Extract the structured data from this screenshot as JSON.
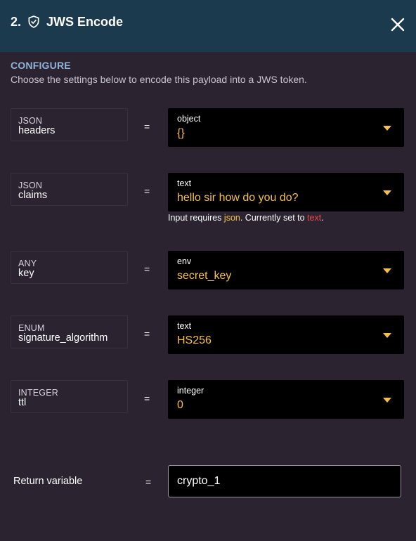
{
  "header": {
    "step_number": "2.",
    "title": "JWS Encode",
    "icon": "shield-check-icon",
    "close_icon": "close-icon"
  },
  "configure": {
    "label": "CONFIGURE",
    "description": "Choose the settings below to encode this payload into a JWS token."
  },
  "fields": [
    {
      "param_type": "JSON",
      "param_name": "headers",
      "equals": "=",
      "value_type": "object",
      "value": "{}"
    },
    {
      "param_type": "JSON",
      "param_name": "claims",
      "equals": "=",
      "value_type": "text",
      "value": "hello sir how do you do?"
    },
    {
      "param_type": "ANY",
      "param_name": "key",
      "equals": "=",
      "value_type": "env",
      "value": "secret_key"
    },
    {
      "param_type": "ENUM",
      "param_name": "signature_algorithm",
      "equals": "=",
      "value_type": "text",
      "value": "HS256"
    },
    {
      "param_type": "INTEGER",
      "param_name": "ttl",
      "equals": "=",
      "value_type": "integer",
      "value": "0"
    }
  ],
  "warning": {
    "prefix": "Input requires ",
    "required_type": "json",
    "middle": ". Currently set to ",
    "current_type": "text",
    "suffix": "."
  },
  "return_variable": {
    "label": "Return variable",
    "equals": "=",
    "value": "crypto_1"
  },
  "colors": {
    "header_bg": "#1c3a4e",
    "body_bg": "#2b2330",
    "accent_value": "#f5c04a",
    "error": "#e84d4d",
    "section_label": "#8fb3d9"
  }
}
